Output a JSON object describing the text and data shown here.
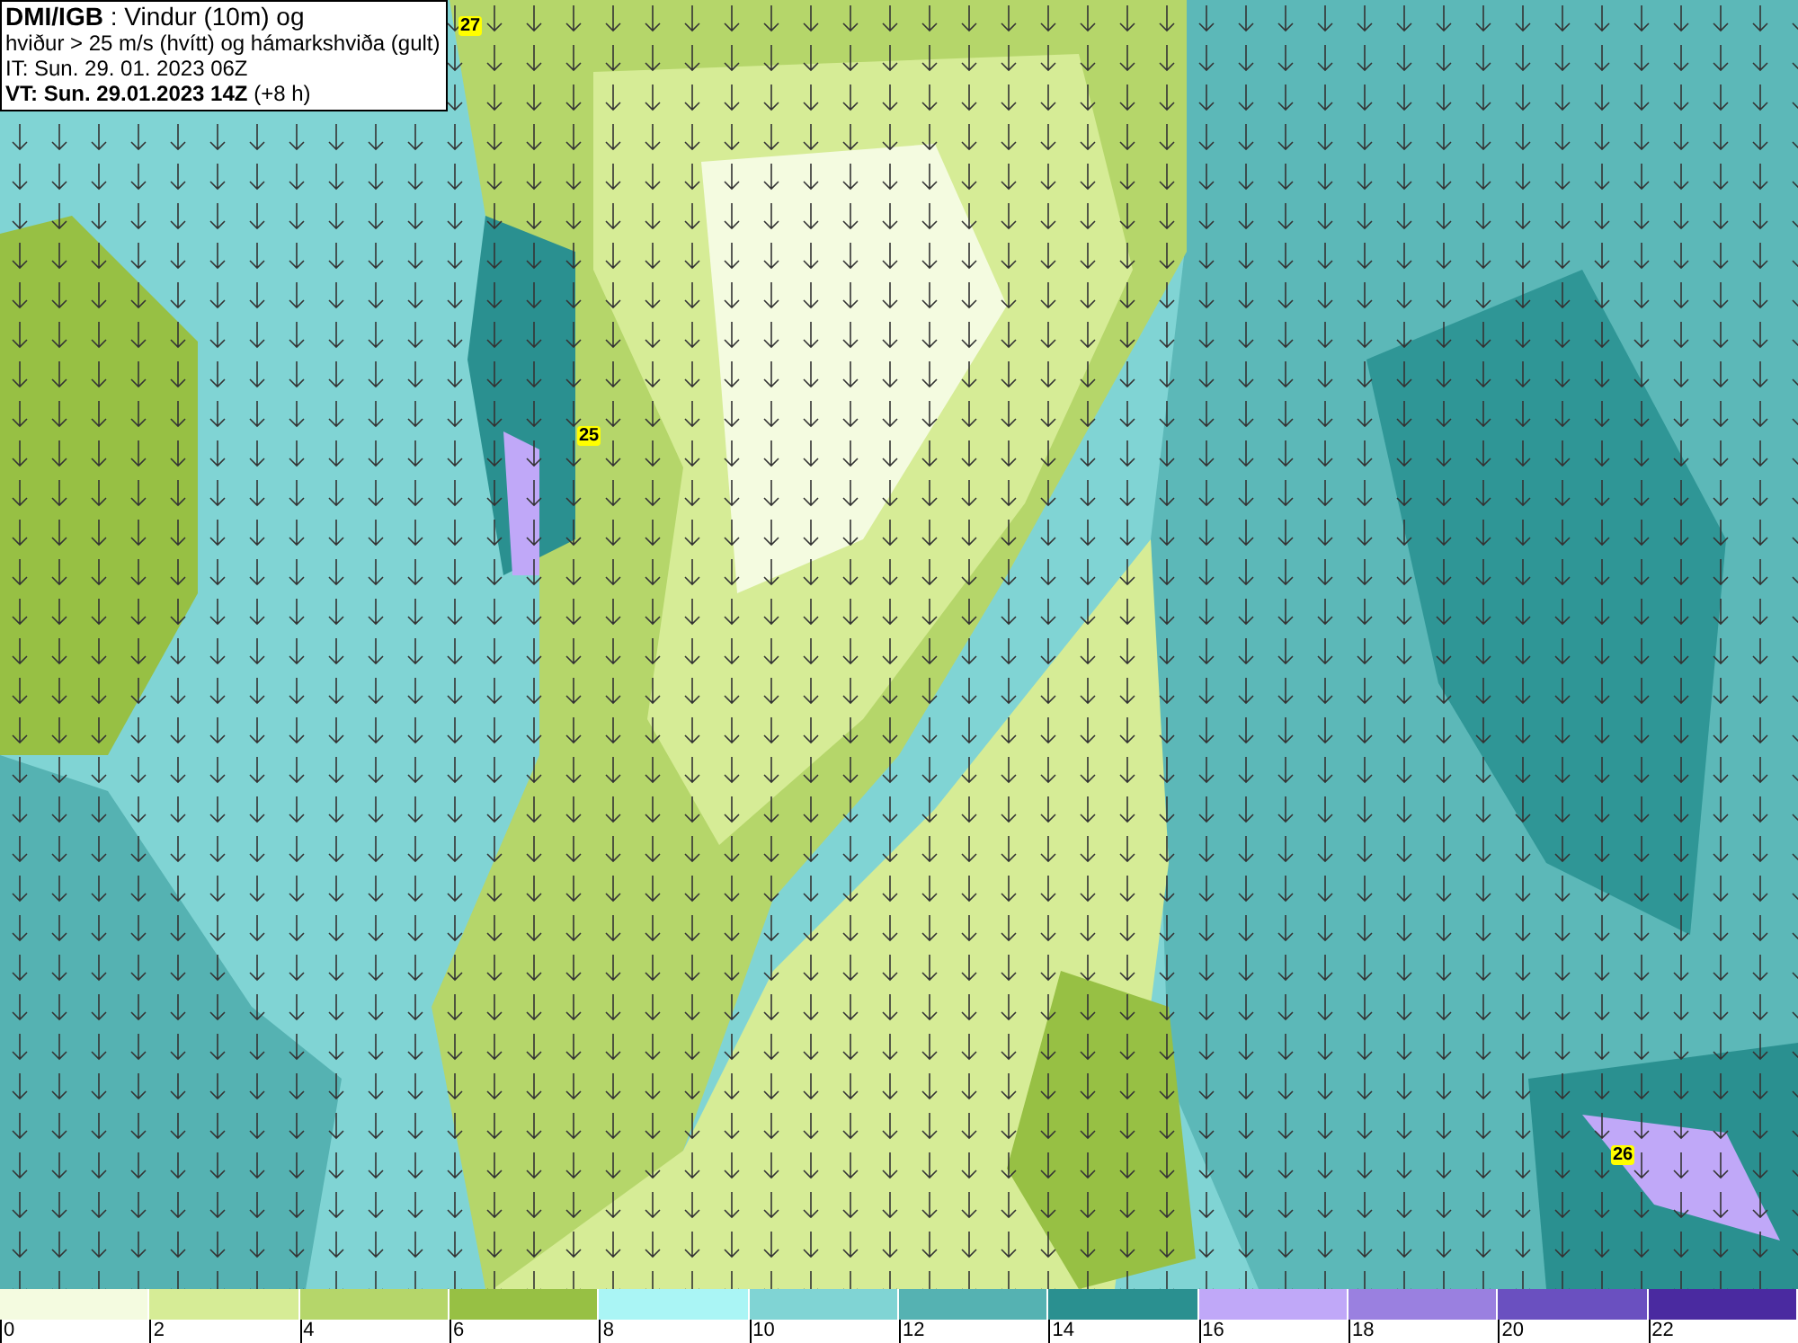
{
  "header": {
    "lines": [
      "**DMI/IGB** : Vindur (10m) og",
      "hviður > 25 m/s (hvítt) og hámarkshviða (gult)",
      "IT: Sun. 29. 01. 2023 06Z",
      "**VT: Sun. 29.01.2023 14Z** (+8 h)"
    ]
  },
  "map": {
    "gust_labels": [
      "27",
      "25",
      "26"
    ]
  },
  "legend": [
    {
      "label": "0",
      "color": "#f4fbe0"
    },
    {
      "label": "2",
      "color": "#d6ec96"
    },
    {
      "label": "4",
      "color": "#b5d66a"
    },
    {
      "label": "6",
      "color": "#97c044"
    },
    {
      "label": "8",
      "color": "#aaf5f5"
    },
    {
      "label": "10",
      "color": "#80d4d4"
    },
    {
      "label": "12",
      "color": "#55b2b2"
    },
    {
      "label": "14",
      "color": "#2a9090"
    },
    {
      "label": "16",
      "color": "#c0a8f8"
    },
    {
      "label": "18",
      "color": "#9a80e0"
    },
    {
      "label": "20",
      "color": "#6a50c0"
    },
    {
      "label": "22",
      "color": "#4a2aa0"
    }
  ]
}
